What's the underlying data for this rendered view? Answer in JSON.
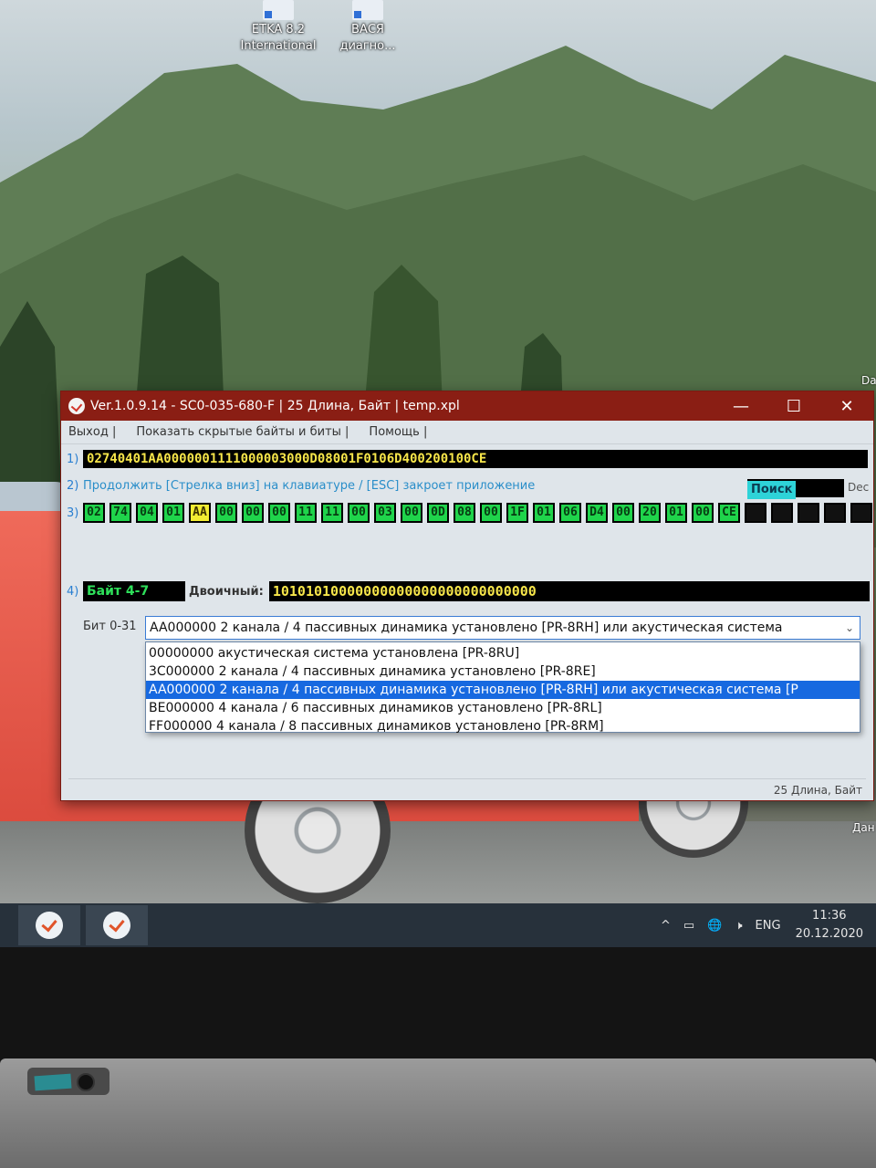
{
  "desktop": {
    "icons": [
      {
        "label_line1": "ETKA 8.2",
        "label_line2": "International"
      },
      {
        "label_line1": "ВАСЯ",
        "label_line2": "диагно..."
      }
    ],
    "edge_labels": [
      "Da",
      "Дан"
    ]
  },
  "window": {
    "title": "Ver.1.0.9.14 -   SC0-035-680-F | 25 Длина, Байт | temp.xpl",
    "controls": {
      "minimize": "—",
      "maximize": "☐",
      "close": "✕"
    },
    "menu": [
      "Выход |",
      "Показать скрытые байты и биты |",
      "Помощь |"
    ],
    "row1": {
      "num": "1)",
      "hex": "02740401AA0000001111000003000D08001F0106D400200100CE"
    },
    "row2": {
      "num": "2)",
      "hint": "Продолжить [Стрелка вниз] на клавиатуре / [ESC] закроет приложение",
      "search_label": "Поиск",
      "dec_label": "Dec"
    },
    "row3": {
      "num": "3)",
      "bytes": [
        "02",
        "74",
        "04",
        "01",
        "AA",
        "00",
        "00",
        "00",
        "11",
        "11",
        "00",
        "03",
        "00",
        "0D",
        "08",
        "00",
        "1F",
        "01",
        "06",
        "D4",
        "00",
        "20",
        "01",
        "00",
        "CE",
        "",
        "",
        "",
        "",
        ""
      ],
      "selected_index": 4
    },
    "row4": {
      "num": "4)",
      "byte_range": "Байт 4-7",
      "binary_label": "Двоичный:",
      "binary_value": "10101010000000000000000000000000"
    },
    "bits": {
      "label": "Бит 0-31",
      "selected_value": "AA000000 2 канала / 4 пассивных динамика установлено [PR-8RH] или акустическая система",
      "options": [
        "00000000 акустическая система установлена [PR-8RU]",
        "3C000000 2 канала / 4 пассивных динамика установлено [PR-8RE]",
        "AA000000 2 канала / 4 пассивных динамика установлено [PR-8RH] или акустическая система [P",
        "BE000000 4 канала / 6 пассивных динамиков установлено [PR-8RL]",
        "FF000000 4 канала / 8 пассивных динамиков установлено [PR-8RM]"
      ],
      "selected_option_index": 2
    },
    "status": "25 Длина, Байт"
  },
  "taskbar": {
    "tray": {
      "caret": "^",
      "lang": "ENG",
      "time": "11:36",
      "date": "20.12.2020"
    }
  }
}
